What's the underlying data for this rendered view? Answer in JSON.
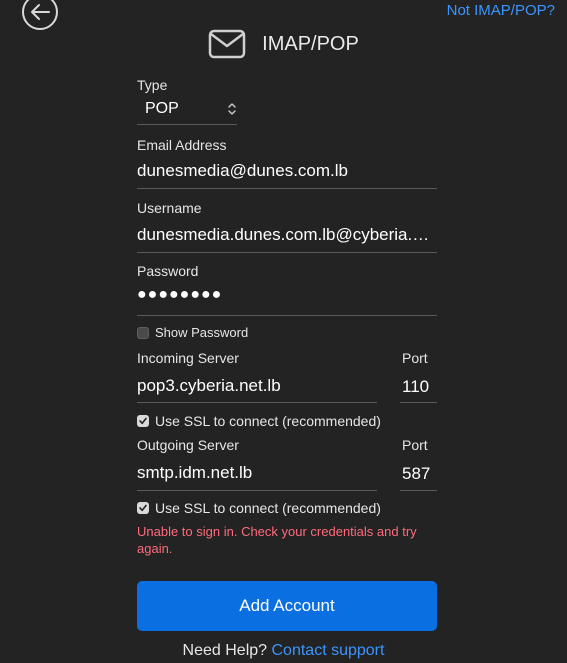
{
  "header": {
    "title": "IMAP/POP",
    "not_imap_link": "Not IMAP/POP?"
  },
  "form": {
    "type_label": "Type",
    "type_value": "POP",
    "email_label": "Email Address",
    "email_value": "dunesmedia@dunes.com.lb",
    "username_label": "Username",
    "username_value": "dunesmedia.dunes.com.lb@cyberia.net.lb",
    "password_label": "Password",
    "password_value": "●●●●●●●●",
    "show_password_label": "Show Password",
    "show_password_checked": false,
    "incoming_label": "Incoming Server",
    "incoming_port_label": "Port",
    "incoming_value": "pop3.cyberia.net.lb",
    "incoming_port_value": "110",
    "incoming_ssl_label": "Use SSL to connect (recommended)",
    "incoming_ssl_checked": true,
    "outgoing_label": "Outgoing Server",
    "outgoing_port_label": "Port",
    "outgoing_value": "smtp.idm.net.lb",
    "outgoing_port_value": "587",
    "outgoing_ssl_label": "Use SSL to connect (recommended)",
    "outgoing_ssl_checked": true,
    "error_message": "Unable to sign in. Check your credentials and try again."
  },
  "actions": {
    "add_account_label": "Add Account",
    "help_text": "Need Help?",
    "contact_support_label": "Contact support"
  },
  "colors": {
    "background": "#232323",
    "accent": "#0a6fe0",
    "link": "#3a95ff",
    "error": "#ff6b7d"
  }
}
